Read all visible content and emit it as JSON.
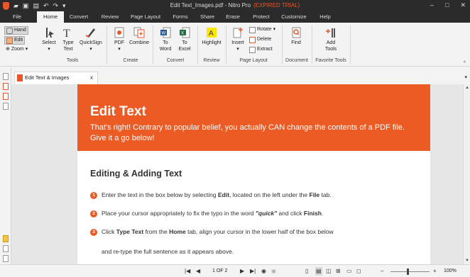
{
  "titlebar": {
    "title": "Edit Text_Images.pdf - Nitro Pro",
    "trial": "(EXPIRED TRIAL)",
    "minimize": "–",
    "maximize": "□",
    "close": "✕"
  },
  "tabs": [
    "File",
    "Home",
    "Convert",
    "Review",
    "Page Layout",
    "Forms",
    "Share",
    "Erase",
    "Protect",
    "Customize",
    "Help"
  ],
  "active_tab": "Home",
  "ribbon": {
    "hand": "Hand",
    "edit": "Edit",
    "zoom": "Zoom",
    "select": "Select",
    "type_text": "Type Text",
    "quicksign": "QuickSign",
    "pdf": "PDF",
    "combine": "Combine",
    "to_word": "To Word",
    "to_excel": "To Excel",
    "highlight": "Highlight",
    "insert": "Insert",
    "rotate": "Rotate",
    "delete": "Delete",
    "extract": "Extract",
    "find": "Find",
    "add_tools": "Add Tools",
    "groups": {
      "tools": "Tools",
      "create": "Create",
      "convert": "Convert",
      "review": "Review",
      "page_layout": "Page Layout",
      "document": "Document",
      "favorite_tools": "Favorite Tools"
    }
  },
  "doc_tab": {
    "label": "Edit Text & Images",
    "close": "x"
  },
  "page": {
    "banner_title": "Edit Text",
    "banner_text": "That's right! Contrary to popular belief, you actually CAN change the contents of a PDF file. Give it a go below!",
    "section_title": "Editing & Adding Text",
    "steps": [
      {
        "num": "1",
        "pre": "Enter the text in the box below by selecting ",
        "b1": "Edit",
        "mid": ", located on the left under the ",
        "b2": "File",
        "post": " tab."
      },
      {
        "num": "2",
        "pre": "Place your cursor appropriately to fix the typo in the word ",
        "i1": "\"quick\"",
        "mid": " and click ",
        "b2": "Finish",
        "post": "."
      },
      {
        "num": "3",
        "pre": "Click ",
        "b1": "Type Text",
        "mid": " from the ",
        "b2": "Home",
        "post": " tab, align your cursor in the lower half of the box below"
      }
    ],
    "step3_cont": "and re-type the full sentence as it appears above."
  },
  "status": {
    "first": "|◀",
    "prev": "◀",
    "page_indicator": "1 OF 2",
    "next": "▶",
    "last": "▶|",
    "zoom_minus": "–",
    "zoom_plus": "+",
    "zoom": "100%"
  },
  "colors": {
    "brand": "#ed5b24",
    "titlebar": "#2b2b2b"
  }
}
